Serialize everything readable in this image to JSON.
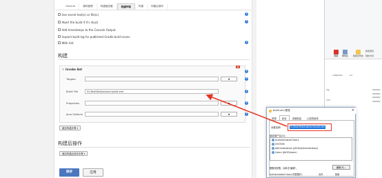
{
  "tabs": [
    "General",
    "源码管理",
    "构建触发器",
    "构建环境",
    "构建",
    "构建后操作"
  ],
  "options": [
    "Use secret text(s) or file(s)",
    "Abort the build if it's stuck",
    "Add timestamps to the Console Output",
    "Inspect build log for published Gradle build scans",
    "With Ant"
  ],
  "build": {
    "section_title": "构建",
    "step_title": "Invoke Ant",
    "delete_label": "X",
    "targets_label": "Targets",
    "build_file_label": "Build File",
    "build_file_value": "D:\\Test\\TestAuto\\src\\build.xml",
    "properties_label": "Properties",
    "java_options_label": "Java Options",
    "expand_label": "▼",
    "add_step_label": "增加构建步骤 ▾"
  },
  "post_build": {
    "section_title": "构建后操作",
    "add_step_label": "增加构建后操作步骤 ▾"
  },
  "buttons": {
    "save": "保存",
    "apply": "应用"
  },
  "explorer": {
    "ribbon_buttons": [
      "删除",
      "重命名",
      "新建文件夹",
      "新建项目",
      "轻松访问"
    ],
    "path_items": [
      "» TestAuto",
      "src"
    ],
    "items": [
      "log",
      "2020/5/",
      "2020/5/",
      "2020/5/",
      "xml",
      "2020/5/"
    ]
  },
  "dialog": {
    "title": "build.xml 属性",
    "close": "✕",
    "tabs": [
      "常规",
      "安全",
      "详细信息",
      "以前的版本"
    ],
    "object_label": "对象名称:",
    "object_value": "D:\\Test\\TestAuto\\src\\build.xml",
    "groups_label": "组或用户名(G):",
    "groups": [
      "Authenticated Users",
      "SYSTEM",
      "Administrators (JACK\\Administrators)",
      "Users (JACK\\Users)"
    ],
    "hint": "要更改权限，请单击\"编辑\"。",
    "edit_button": "编辑(E)...",
    "perm_header": "Authenticated Users 的权限(P)",
    "perm_allow": "允许",
    "perm_deny": "拒绝"
  },
  "colors": {
    "save_button": "#4b77be",
    "highlight_outline": "#e53323",
    "arrow": "#e53323",
    "help_icon": "#2f7bd7"
  }
}
